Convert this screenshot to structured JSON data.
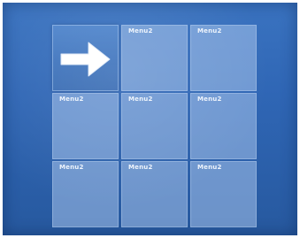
{
  "menu": {
    "selected_icon": "right-arrow-icon",
    "items": [
      {
        "label": ""
      },
      {
        "label": "Menu2"
      },
      {
        "label": "Menu2"
      },
      {
        "label": "Menu2"
      },
      {
        "label": "Menu2"
      },
      {
        "label": "Menu2"
      },
      {
        "label": "Menu2"
      },
      {
        "label": "Menu2"
      },
      {
        "label": "Menu2"
      }
    ]
  },
  "colors": {
    "background": "#2f66b5",
    "tile": "#a5c3eb",
    "selected_tile": "#3f74bd",
    "label": "#eef4fc"
  }
}
